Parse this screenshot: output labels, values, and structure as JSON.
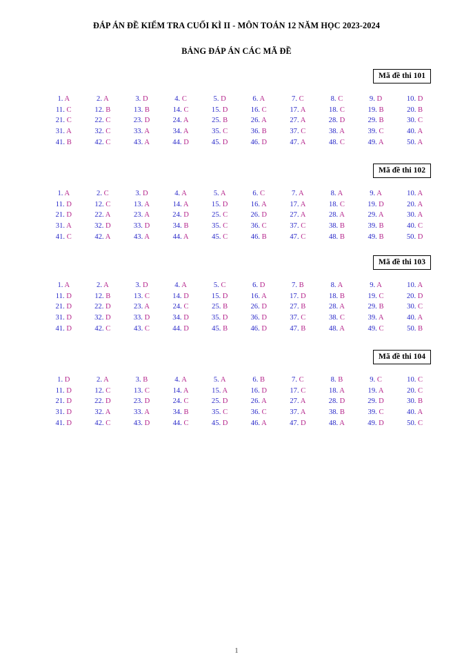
{
  "document": {
    "title_main": "ĐÁP ÁN ĐỀ KIỂM TRA CUỐI KÌ II - MÔN TOÁN 12 NĂM HỌC 2023-2024",
    "title_sub": "BẢNG ĐÁP ÁN CÁC MÃ ĐỀ",
    "page_number": "1"
  },
  "colors": {
    "number": "#2626c8",
    "letter": "#b5268c",
    "text": "#000000",
    "box_border": "#000000",
    "background": "#ffffff"
  },
  "blocks": [
    {
      "code_label": "Mã đề thi 101",
      "exam_code": "101",
      "answers": [
        "A",
        "A",
        "D",
        "C",
        "D",
        "A",
        "C",
        "C",
        "D",
        "D",
        "C",
        "B",
        "B",
        "C",
        "D",
        "C",
        "A",
        "C",
        "B",
        "B",
        "C",
        "C",
        "D",
        "A",
        "B",
        "A",
        "A",
        "D",
        "B",
        "C",
        "A",
        "C",
        "A",
        "A",
        "C",
        "B",
        "C",
        "A",
        "C",
        "A",
        "B",
        "C",
        "A",
        "D",
        "D",
        "D",
        "A",
        "C",
        "A",
        "A"
      ]
    },
    {
      "code_label": "Mã đề thi 102",
      "exam_code": "102",
      "answers": [
        "A",
        "C",
        "D",
        "A",
        "A",
        "C",
        "A",
        "A",
        "A",
        "A",
        "D",
        "C",
        "A",
        "A",
        "D",
        "A",
        "A",
        "C",
        "D",
        "A",
        "D",
        "A",
        "A",
        "D",
        "C",
        "D",
        "A",
        "A",
        "A",
        "A",
        "A",
        "D",
        "D",
        "B",
        "C",
        "C",
        "C",
        "B",
        "B",
        "C",
        "C",
        "A",
        "A",
        "A",
        "C",
        "B",
        "C",
        "B",
        "B",
        "D"
      ]
    },
    {
      "code_label": "Mã đề thi 103",
      "exam_code": "103",
      "answers": [
        "A",
        "A",
        "D",
        "A",
        "C",
        "D",
        "B",
        "A",
        "A",
        "A",
        "D",
        "B",
        "C",
        "D",
        "D",
        "A",
        "D",
        "B",
        "C",
        "D",
        "D",
        "D",
        "A",
        "C",
        "B",
        "D",
        "B",
        "A",
        "B",
        "C",
        "D",
        "D",
        "D",
        "D",
        "D",
        "D",
        "C",
        "C",
        "A",
        "A",
        "D",
        "C",
        "C",
        "D",
        "B",
        "D",
        "B",
        "A",
        "C",
        "B"
      ]
    },
    {
      "code_label": "Mã đề thi 104",
      "exam_code": "104",
      "answers": [
        "D",
        "A",
        "B",
        "A",
        "A",
        "B",
        "C",
        "B",
        "C",
        "C",
        "D",
        "C",
        "C",
        "A",
        "A",
        "D",
        "C",
        "A",
        "A",
        "C",
        "D",
        "D",
        "D",
        "C",
        "D",
        "A",
        "A",
        "D",
        "D",
        "B",
        "D",
        "A",
        "A",
        "B",
        "C",
        "C",
        "A",
        "B",
        "C",
        "A",
        "D",
        "C",
        "D",
        "C",
        "D",
        "A",
        "D",
        "A",
        "D",
        "C"
      ]
    }
  ],
  "layout": {
    "block_tops": [
      100,
      237,
      370,
      507
    ],
    "columns": 10,
    "rows": 5
  }
}
